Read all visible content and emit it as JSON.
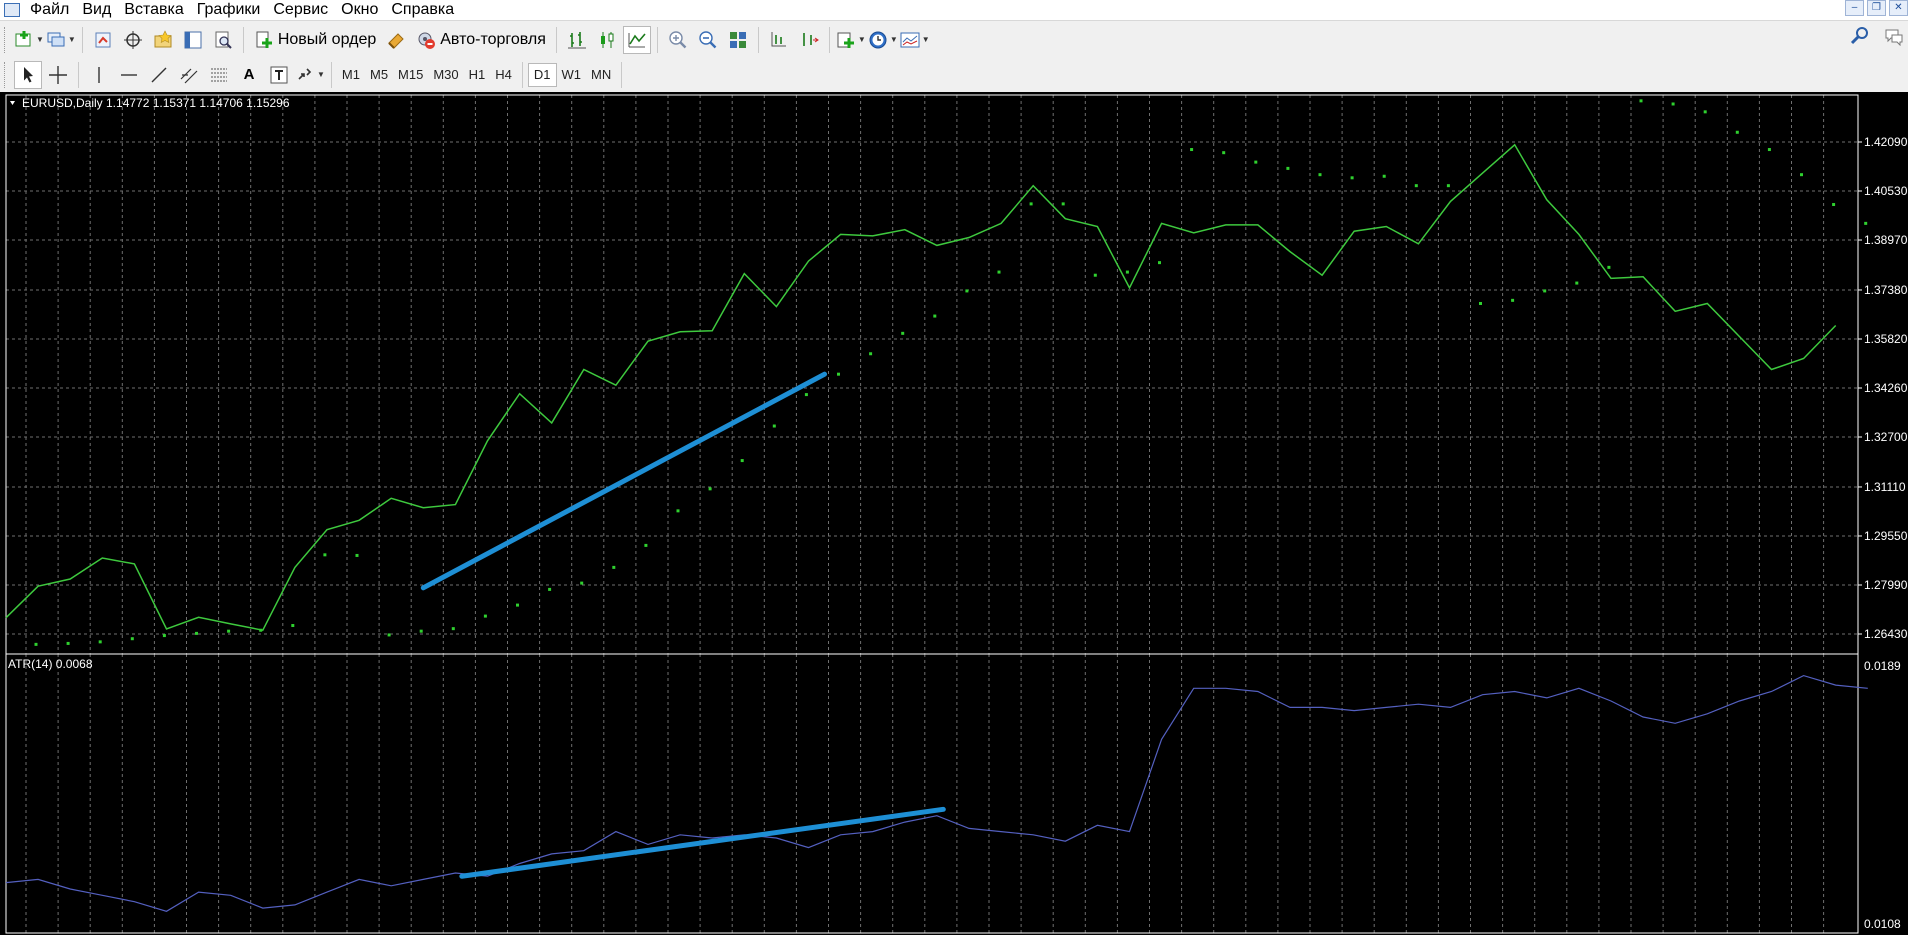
{
  "menu": {
    "items": [
      "Файл",
      "Вид",
      "Вставка",
      "Графики",
      "Сервис",
      "Окно",
      "Справка"
    ]
  },
  "toolbar": {
    "new_order_label": "Новый ордер",
    "autotrading_label": "Авто-торговля",
    "timeframes": [
      "M1",
      "M5",
      "M15",
      "M30",
      "H1",
      "H4",
      "D1",
      "W1",
      "MN"
    ],
    "active_timeframe": "D1"
  },
  "chart": {
    "header": "EURUSD,Daily  1.14772 1.15371 1.14706 1.15296",
    "line_color": "#3ec93e",
    "sar_color": "#2fd12f",
    "annotation_color": "#1e8fd5",
    "atr_color": "#5460c0"
  },
  "indicator": {
    "header": "ATR(14) 0.0068"
  },
  "chart_data": [
    {
      "type": "line",
      "title": "EURUSD,Daily",
      "ohlc": {
        "open": "1.14772",
        "high": "1.15371",
        "low": "1.14706",
        "close": "1.15296"
      },
      "y_ticks": [
        "1.42090",
        "1.40530",
        "1.38970",
        "1.37380",
        "1.35820",
        "1.34260",
        "1.32700",
        "1.31110",
        "1.29550",
        "1.27990",
        "1.26430"
      ],
      "ylim": [
        1.258,
        1.432
      ],
      "series": [
        {
          "values": [
            1.2695,
            1.2795,
            1.2818,
            1.2885,
            1.2866,
            1.2659,
            1.2696,
            1.2675,
            1.2655,
            1.2855,
            1.2975,
            1.3005,
            1.3075,
            1.3045,
            1.3055,
            1.3258,
            1.3408,
            1.3315,
            1.3485,
            1.3435,
            1.3575,
            1.3605,
            1.3608,
            1.379,
            1.3685,
            1.383,
            1.3915,
            1.391,
            1.393,
            1.388,
            1.3905,
            1.395,
            1.407,
            1.3965,
            1.394,
            1.3745,
            1.395,
            1.392,
            1.3945,
            1.3945,
            1.386,
            1.3785,
            1.3925,
            1.394,
            1.3885,
            1.402,
            1.411,
            1.42,
            1.4025,
            1.3915,
            1.3775,
            1.378,
            1.367,
            1.3695,
            1.359,
            1.3485,
            1.352,
            1.3625
          ]
        },
        {
          "values": [
            1.261,
            1.2613,
            1.2618,
            1.2628,
            1.2638,
            1.2645,
            1.2652,
            1.2655,
            1.267,
            1.2895,
            1.2893,
            1.264,
            1.2652,
            1.266,
            1.27,
            1.2735,
            1.2785,
            1.2805,
            1.2855,
            1.2925,
            1.3035,
            1.3105,
            1.3195,
            1.3305,
            1.3405,
            1.347,
            1.3535,
            1.36,
            1.3655,
            1.3735,
            1.3795,
            1.4012,
            1.4012,
            1.3785,
            1.3795,
            1.3825,
            1.4185,
            1.4175,
            1.4145,
            1.4125,
            1.4105,
            1.4095,
            1.41,
            1.407,
            1.407,
            1.3695,
            1.3705,
            1.3735,
            1.376,
            1.381,
            1.434,
            1.433,
            1.4305,
            1.424,
            1.4185,
            1.4105,
            1.401,
            1.395
          ]
        }
      ],
      "annotations": [
        {
          "type": "trendline",
          "from": [
            13,
            1.279
          ],
          "to": [
            25.5,
            1.347
          ]
        }
      ]
    },
    {
      "type": "line",
      "title": "ATR(14)",
      "value_label": "0.0068",
      "y_ticks": [
        "0.0189",
        "0.0108"
      ],
      "ylim": [
        0.0108,
        0.0189
      ],
      "series": [
        {
          "values": [
            0.0121,
            0.0122,
            0.0119,
            0.0117,
            0.0115,
            0.0112,
            0.0118,
            0.0117,
            0.0113,
            0.0114,
            0.0118,
            0.0122,
            0.012,
            0.0122,
            0.0124,
            0.0123,
            0.0127,
            0.013,
            0.0131,
            0.0137,
            0.0133,
            0.0136,
            0.0135,
            0.0136,
            0.0135,
            0.0132,
            0.0136,
            0.0137,
            0.014,
            0.0142,
            0.0138,
            0.0137,
            0.0136,
            0.0134,
            0.0139,
            0.0137,
            0.0166,
            0.0182,
            0.0182,
            0.0181,
            0.0176,
            0.0176,
            0.0175,
            0.0176,
            0.0177,
            0.0176,
            0.018,
            0.0181,
            0.0179,
            0.0182,
            0.0178,
            0.0173,
            0.0171,
            0.0174,
            0.0178,
            0.0181,
            0.0186,
            0.0183,
            0.0182
          ]
        }
      ],
      "annotations": [
        {
          "type": "trendline",
          "from": [
            14.2,
            0.0123
          ],
          "to": [
            29.2,
            0.0144
          ]
        }
      ]
    }
  ]
}
